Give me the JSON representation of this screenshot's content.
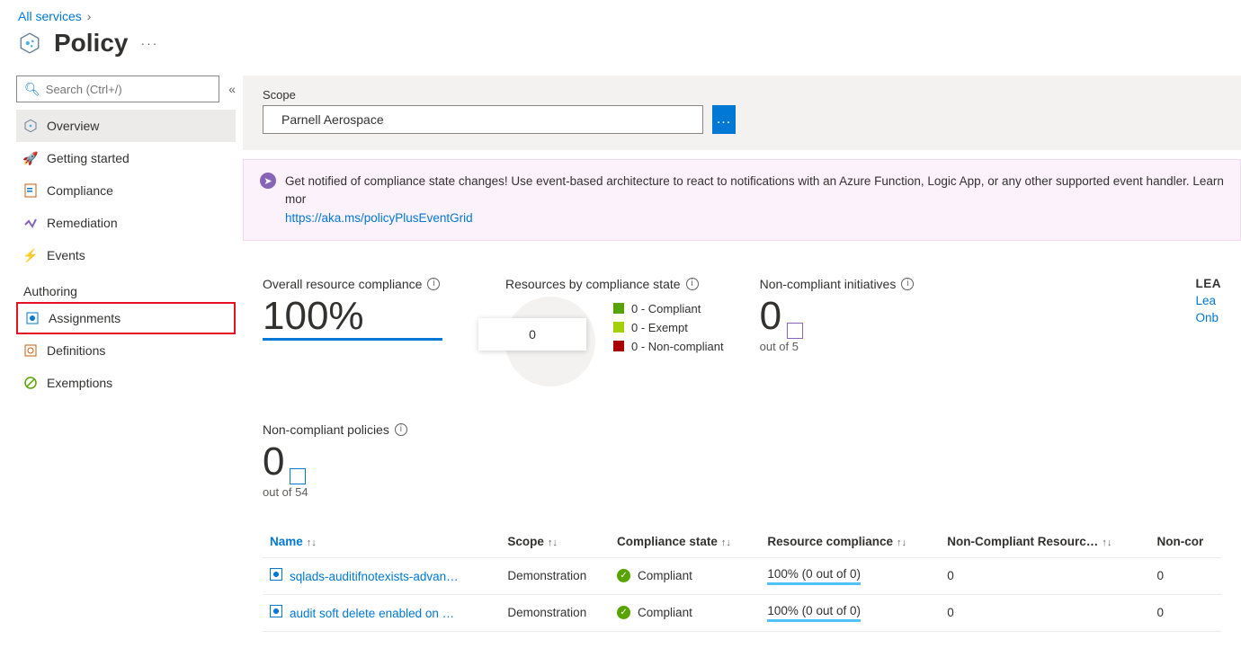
{
  "breadcrumb": {
    "parent": "All services"
  },
  "page": {
    "title": "Policy"
  },
  "search": {
    "placeholder": "Search (Ctrl+/)"
  },
  "nav": {
    "overview": "Overview",
    "getting_started": "Getting started",
    "compliance": "Compliance",
    "remediation": "Remediation",
    "events": "Events"
  },
  "authoring": {
    "label": "Authoring",
    "assignments": "Assignments",
    "definitions": "Definitions",
    "exemptions": "Exemptions"
  },
  "scope": {
    "label": "Scope",
    "value": "Parnell Aerospace",
    "button": "..."
  },
  "notification": {
    "text": "Get notified of compliance state changes! Use event-based architecture to react to notifications with an Azure Function, Logic App, or any other supported event handler. Learn mor",
    "link_text": "https://aka.ms/policyPlusEventGrid"
  },
  "metrics": {
    "overall_title": "Overall resource compliance",
    "overall_value": "100%",
    "resources_title": "Resources by compliance state",
    "donut_value": "0",
    "legend": {
      "compliant": "0 - Compliant",
      "exempt": "0 - Exempt",
      "noncompliant": "0 - Non-compliant"
    },
    "noncomp_init_title": "Non-compliant initiatives",
    "noncomp_init_value": "0",
    "noncomp_init_sub": "out of 5",
    "learn_heading": "LEA",
    "learn_link1": "Lea",
    "learn_link2": "Onb"
  },
  "policies": {
    "title": "Non-compliant policies",
    "value": "0",
    "sub": "out of 54"
  },
  "table": {
    "headers": {
      "name": "Name",
      "scope": "Scope",
      "compliance_state": "Compliance state",
      "resource_compliance": "Resource compliance",
      "noncomp_resources": "Non-Compliant Resourc…",
      "noncomp": "Non-cor"
    },
    "rows": [
      {
        "name": "sqlads-auditifnotexists-advan…",
        "scope": "Demonstration",
        "state": "Compliant",
        "resource": "100% (0 out of 0)",
        "ncr": "0",
        "nc": "0"
      },
      {
        "name": "audit soft delete enabled on …",
        "scope": "Demonstration",
        "state": "Compliant",
        "resource": "100% (0 out of 0)",
        "ncr": "0",
        "nc": "0"
      }
    ]
  }
}
